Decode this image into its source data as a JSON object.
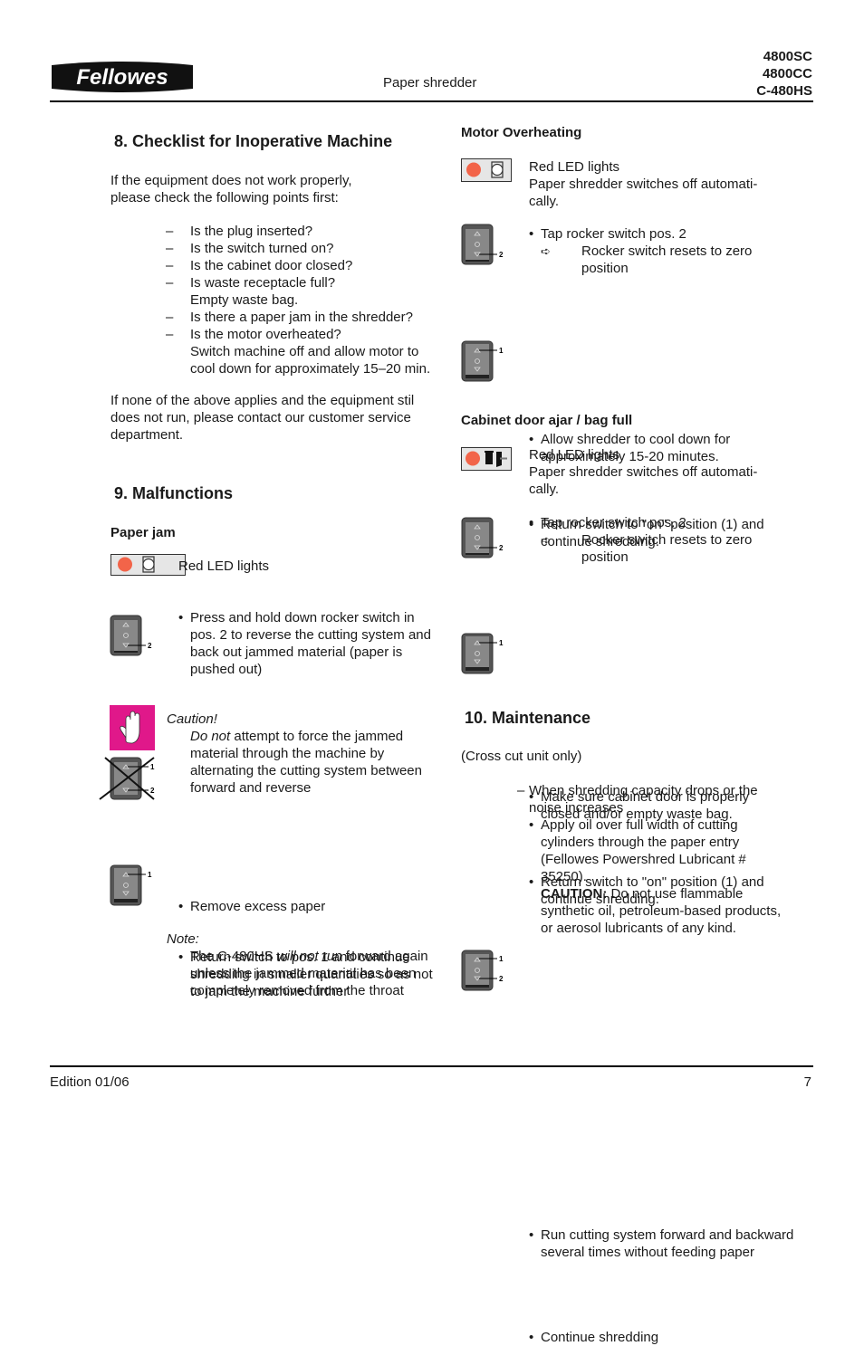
{
  "header": {
    "brand": "Fellowes",
    "subtitle": "Paper shredder",
    "models": [
      "4800SC",
      "4800CC",
      "C-480HS"
    ]
  },
  "footer": {
    "edition": "Edition 01/06",
    "page": "7"
  },
  "section8": {
    "title": "8.   Checklist for Inoperative Machine",
    "intro": "If  the equipment does not work properly, please check the following points first:",
    "items": [
      {
        "dash": "–",
        "text": "Is the plug inserted?"
      },
      {
        "dash": "–",
        "text": "Is the switch turned on?"
      },
      {
        "dash": "–",
        "text": "Is the cabinet door closed?"
      },
      {
        "dash": "–",
        "text": "Is waste receptacle full?",
        "sub": "Empty waste bag."
      },
      {
        "dash": "–",
        "text": "Is there a paper jam in the shredder?"
      },
      {
        "dash": "–",
        "text": "Is the motor overheated?",
        "sub": "Switch machine off and allow motor to cool down for approximately 15–20 min."
      }
    ],
    "outro": "If none of the above applies and the equipment stil does not run, please contact our customer service department."
  },
  "section9": {
    "title": "9.   Malfunctions",
    "paper_jam": {
      "heading": "Paper jam",
      "led_text": "Red LED lights",
      "step1": "Press and hold down rocker switch in pos. 2 to reverse the cutting system and back out jammed material (paper is pushed out)",
      "caution_label": "Caution!",
      "caution_em": "Do not",
      "caution_text": " attempt to force the jammed material through the machine by alternating the cutting system between forward and reverse",
      "step2": "Remove excess paper",
      "step3": "Return switch to pos. 1 and continue shredding in smaller quantities so as not to jam the machine further",
      "note_label": "Note:",
      "note_pre": "The C-480HS ",
      "note_em": "will not run",
      "note_post": " forward again unless the jammed material has been completely removed from the throat"
    },
    "motor": {
      "heading": "Motor Overheating",
      "led_line1": "Red LED lights",
      "led_line2": "Paper shredder switches off automati-cally.",
      "step1": "Tap rocker switch pos. 2",
      "step1_result": "Rocker switch resets to zero position",
      "step2": "Allow shredder to cool down for approximately 15-20 minutes.",
      "step3": "Return switch to \"on\" position (1) and continue shredding."
    },
    "cabinet": {
      "heading": "Cabinet door ajar / bag full",
      "led_line1": "Red LED lights",
      "led_line2": "Paper shredder switches off automati-cally.",
      "step1": "Tap rocker switch pos. 2",
      "step1_result": "Rocker switch resets to zero position",
      "step2": "Make sure cabinet door is properly closed and/or empty waste bag.",
      "step3": "Return switch to \"on\" position (1) and continue shredding."
    }
  },
  "section10": {
    "title": "10. Maintenance",
    "note": "(Cross cut unit only)",
    "condition": "When shredding capacity drops or the noise increases",
    "step1": "Apply oil over full width of cutting cylinders through the paper entry (Fellowes Powershred Lubricant # 35250).",
    "caution_label": "CAUTION:",
    "caution_text": " Do not use flammable synthetic oil, petroleum-based products, or aerosol lubricants of any kind.",
    "step2": "Run cutting system forward and backward several times without feeding paper",
    "step3": "Continue shredding"
  },
  "symbols": {
    "bullet": "•",
    "arrow": "➪",
    "dash": "–",
    "pos1": "1",
    "pos2": "2"
  },
  "colors": {
    "led_red": "#f26449",
    "caution_magenta": "#e0188a"
  }
}
